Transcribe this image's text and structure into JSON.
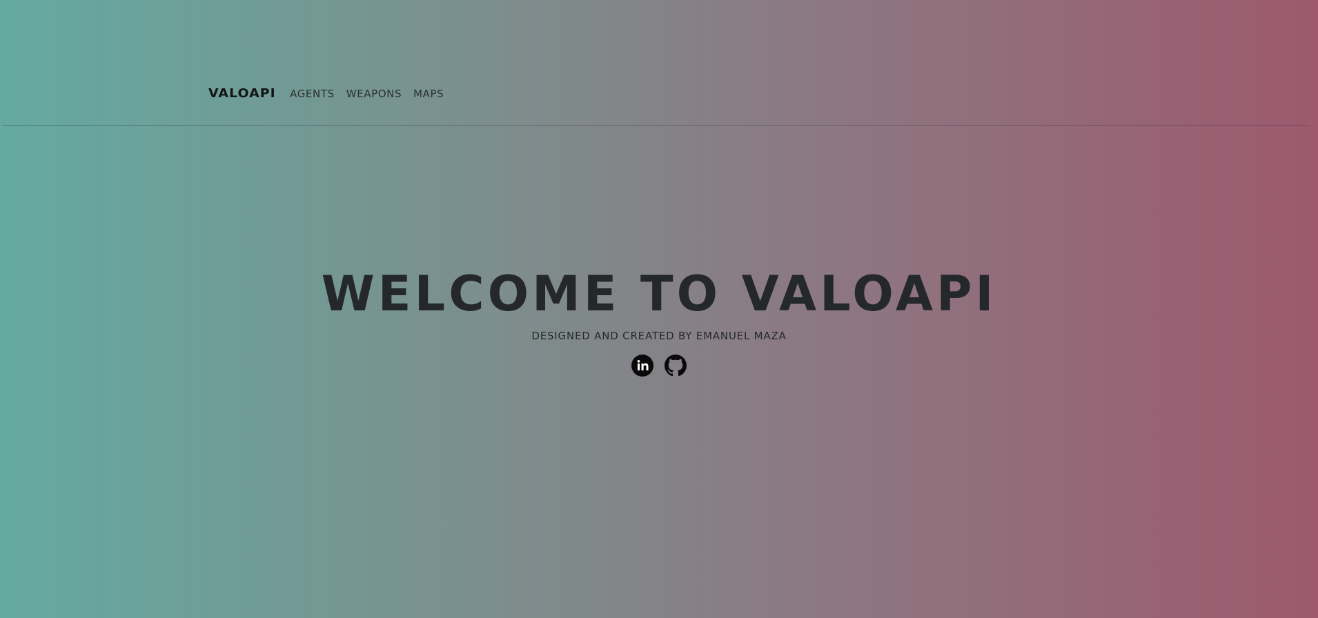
{
  "nav": {
    "brand": "VALOAPI",
    "links": [
      {
        "label": "AGENTS"
      },
      {
        "label": "WEAPONS"
      },
      {
        "label": "MAPS"
      }
    ]
  },
  "hero": {
    "title": "WELCOME TO VALOAPI",
    "subtitle": "DESIGNED AND CREATED BY EMANUEL MAZA"
  },
  "socials": [
    {
      "icon": "linkedin-icon"
    },
    {
      "icon": "github-icon"
    }
  ],
  "colors": {
    "gradient_start": "#64aaa0",
    "gradient_end": "#9d596e",
    "text": "#25282b"
  }
}
